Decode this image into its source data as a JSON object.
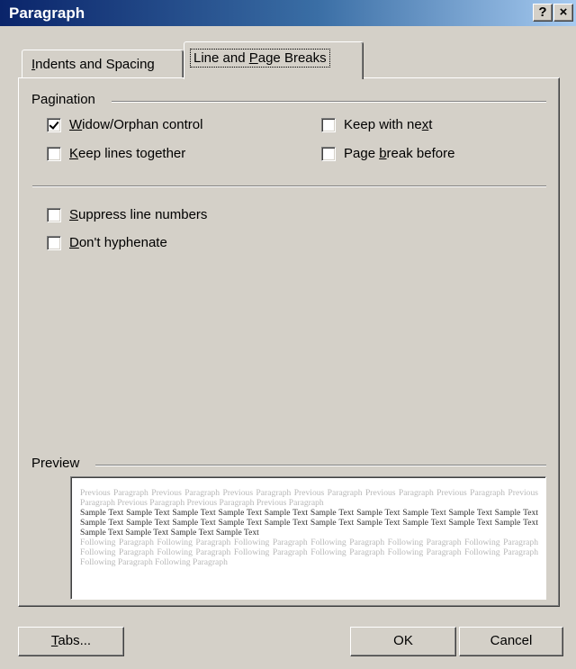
{
  "window": {
    "title": "Paragraph",
    "help_label": "?",
    "close_label": "×"
  },
  "tabs": [
    {
      "label": "Indents and Spacing",
      "mnemonic": "I",
      "rest": "ndents and Spacing",
      "active": false
    },
    {
      "label": "Line and Page Breaks",
      "pre": "Line and ",
      "mnemonic": "P",
      "rest": "age Breaks",
      "active": true
    }
  ],
  "pagination": {
    "label": "Pagination",
    "widow_orphan": {
      "pre": "",
      "mnemonic": "W",
      "rest": "idow/Orphan control",
      "checked": true
    },
    "keep_lines": {
      "pre": "",
      "mnemonic": "K",
      "rest": "eep lines together",
      "checked": false
    },
    "keep_next": {
      "pre": "Keep with ne",
      "mnemonic": "x",
      "rest": "t",
      "checked": false
    },
    "page_break": {
      "pre": "Page ",
      "mnemonic": "b",
      "rest": "reak before",
      "checked": false
    }
  },
  "other": {
    "suppress": {
      "pre": "",
      "mnemonic": "S",
      "rest": "uppress line numbers",
      "checked": false
    },
    "hyphenate": {
      "pre": "",
      "mnemonic": "D",
      "rest": "on't hyphenate",
      "checked": false
    }
  },
  "preview": {
    "label": "Preview",
    "previous_text": "Previous Paragraph Previous Paragraph Previous Paragraph Previous Paragraph Previous Paragraph Previous Paragraph Previous Paragraph Previous Paragraph Previous Paragraph Previous Paragraph",
    "sample_text": "Sample Text Sample Text Sample Text Sample Text Sample Text Sample Text Sample Text Sample Text Sample Text Sample Text Sample Text Sample Text Sample Text Sample Text Sample Text Sample Text Sample Text Sample Text Sample Text Sample Text Sample Text Sample Text Sample Text Sample Text",
    "following_text": "Following Paragraph Following Paragraph Following Paragraph Following Paragraph Following Paragraph Following Paragraph Following Paragraph Following Paragraph Following Paragraph Following Paragraph Following Paragraph Following Paragraph Following Paragraph Following Paragraph"
  },
  "buttons": {
    "tabs": {
      "mnemonic": "T",
      "rest": "abs..."
    },
    "ok": "OK",
    "cancel": "Cancel"
  },
  "colors": {
    "title_gradient_start": "#0a246a",
    "title_gradient_end": "#a6caf0",
    "face": "#d4d0c8"
  }
}
